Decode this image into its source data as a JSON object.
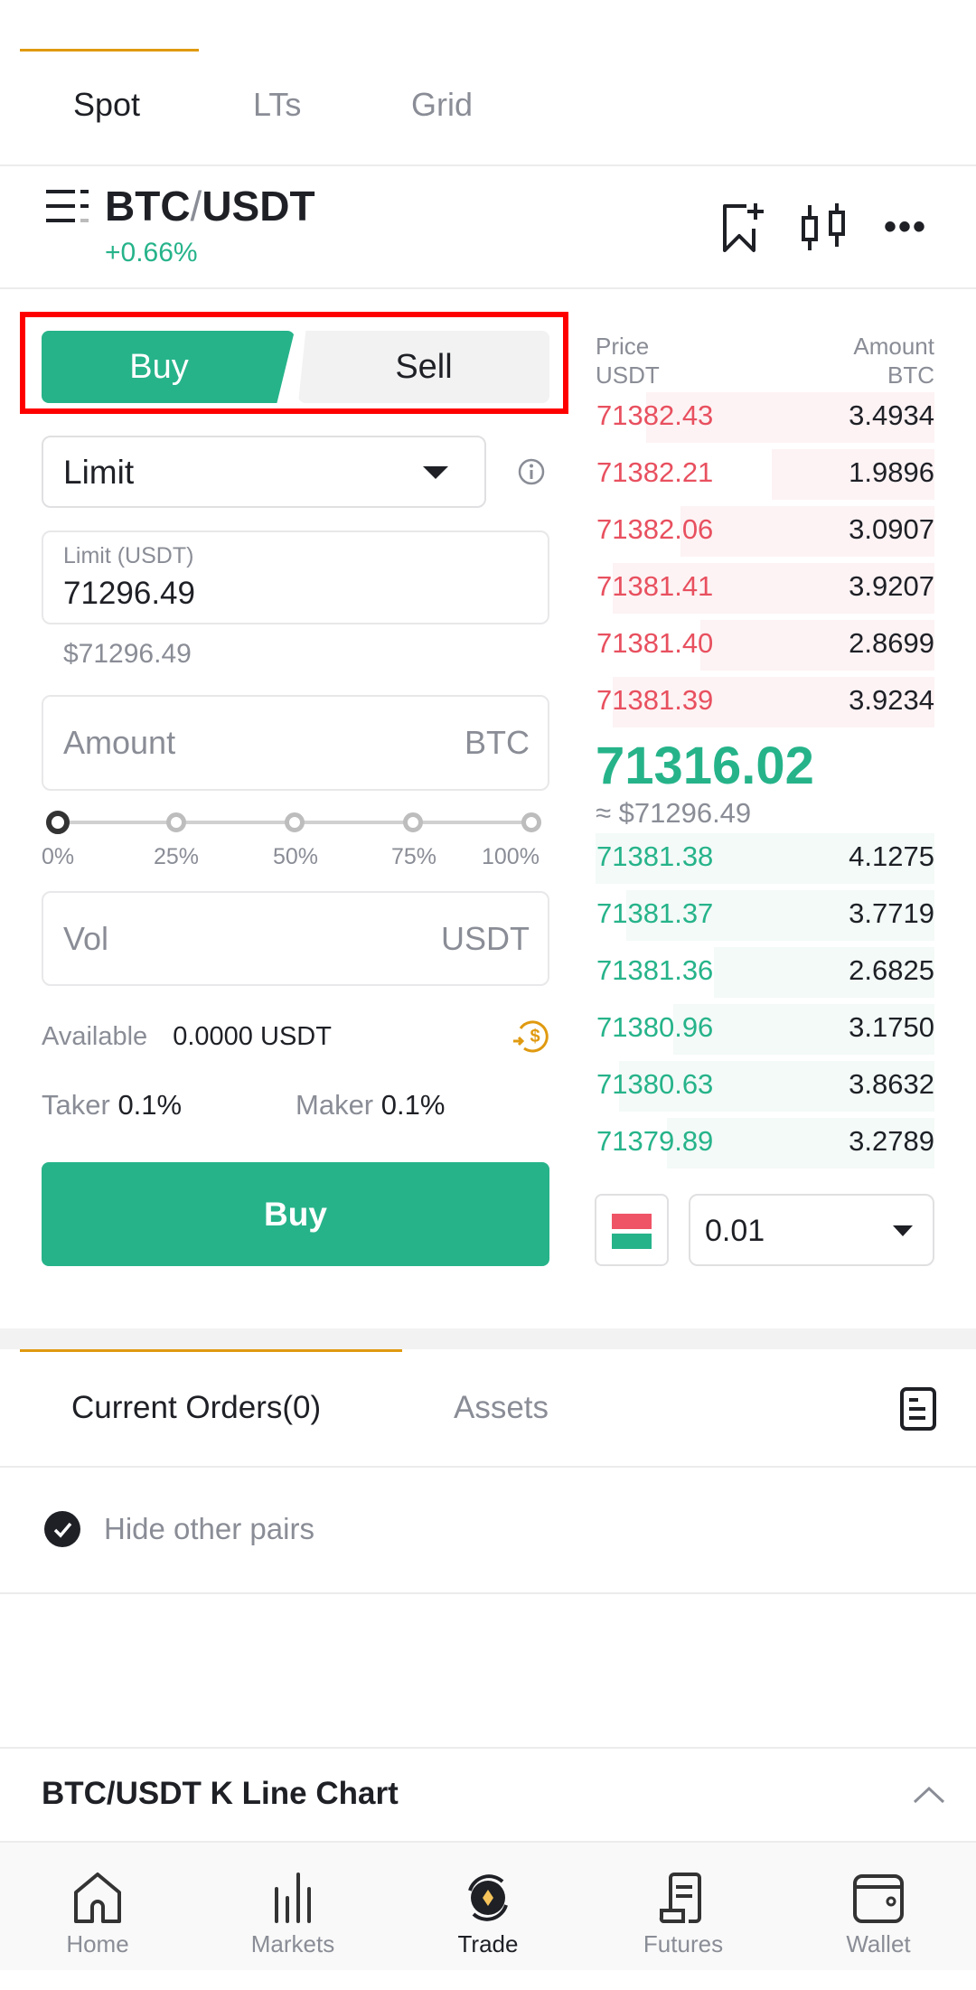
{
  "top_tabs": [
    {
      "label": "Spot",
      "active": true
    },
    {
      "label": "LTs"
    },
    {
      "label": "Grid"
    }
  ],
  "pair": {
    "name_base": "BTC",
    "sep": "/",
    "name_quote": "USDT",
    "change": "+0.66%"
  },
  "header_icons": [
    "menu-icon",
    "bookmark-add-icon",
    "candlestick-icon",
    "more-icon"
  ],
  "side_toggle": {
    "buy": "Buy",
    "sell": "Sell",
    "selected": "Buy"
  },
  "order_type": {
    "value": "Limit"
  },
  "limit_field": {
    "label": "Limit (USDT)",
    "value": "71296.49",
    "usd": "$71296.49"
  },
  "amount_field": {
    "placeholder": "Amount",
    "unit": "BTC"
  },
  "slider": {
    "value": 0,
    "labels": [
      "0%",
      "25%",
      "50%",
      "75%",
      "100%"
    ]
  },
  "vol_field": {
    "placeholder": "Vol",
    "unit": "USDT"
  },
  "available": {
    "label": "Available",
    "value": "0.0000",
    "unit": "USDT"
  },
  "fees": {
    "taker_label": "Taker",
    "taker": "0.1%",
    "maker_label": "Maker",
    "maker": "0.1%"
  },
  "buy_button": "Buy",
  "orderbook": {
    "price_header": "Price",
    "price_unit": "USDT",
    "amount_header": "Amount",
    "amount_unit": "BTC",
    "asks": [
      {
        "price": "71382.43",
        "amount": "3.4934",
        "depth": 0.85
      },
      {
        "price": "71382.21",
        "amount": "1.9896",
        "depth": 0.48
      },
      {
        "price": "71382.06",
        "amount": "3.0907",
        "depth": 0.75
      },
      {
        "price": "71381.41",
        "amount": "3.9207",
        "depth": 0.95
      },
      {
        "price": "71381.40",
        "amount": "2.8699",
        "depth": 0.69
      },
      {
        "price": "71381.39",
        "amount": "3.9234",
        "depth": 0.95
      }
    ],
    "last_price": "71316.02",
    "last_price_usd": "≈ $71296.49",
    "bids": [
      {
        "price": "71381.38",
        "amount": "4.1275",
        "depth": 1.0
      },
      {
        "price": "71381.37",
        "amount": "3.7719",
        "depth": 0.91
      },
      {
        "price": "71381.36",
        "amount": "2.6825",
        "depth": 0.65
      },
      {
        "price": "71380.96",
        "amount": "3.1750",
        "depth": 0.77
      },
      {
        "price": "71380.63",
        "amount": "3.8632",
        "depth": 0.93
      },
      {
        "price": "71379.89",
        "amount": "3.2789",
        "depth": 0.79
      }
    ],
    "precision": "0.01"
  },
  "orders_tabs": [
    {
      "label": "Current Orders(0)",
      "active": true
    },
    {
      "label": "Assets"
    }
  ],
  "hide_other_pairs": {
    "label": "Hide other pairs",
    "checked": true
  },
  "kline_section": {
    "title": "BTC/USDT K Line Chart"
  },
  "bottom_nav": [
    {
      "label": "Home"
    },
    {
      "label": "Markets"
    },
    {
      "label": "Trade",
      "active": true
    },
    {
      "label": "Futures"
    },
    {
      "label": "Wallet"
    }
  ],
  "colors": {
    "buy": "#26b38a",
    "sell": "#e8505f",
    "accent": "#e09a10",
    "highlight_box": "#ff0000"
  }
}
